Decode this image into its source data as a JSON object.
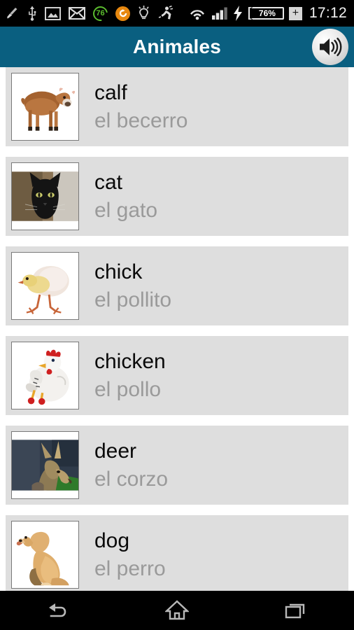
{
  "statusbar": {
    "clock": "17:12",
    "badge_count": "76",
    "battery_percent": "76%",
    "battery_plus": "+",
    "icons": [
      "broom-icon",
      "usb-icon",
      "screenshot-image-icon",
      "mail-icon",
      "cleaner-badge-icon",
      "orange-sync-icon",
      "lightbulb-icon",
      "runner-icon",
      "wifi-icon",
      "cell-signal-icon",
      "charging-bolt-icon",
      "battery-icon",
      "battery-plus-icon"
    ]
  },
  "titlebar": {
    "title": "Animales",
    "speaker_label": "speaker",
    "background_color": "#0a5f80"
  },
  "list": {
    "items": [
      {
        "english": "calf",
        "spanish": "el becerro",
        "image": "calf-photo"
      },
      {
        "english": "cat",
        "spanish": "el gato",
        "image": "cat-photo"
      },
      {
        "english": "chick",
        "spanish": "el pollito",
        "image": "chick-photo"
      },
      {
        "english": "chicken",
        "spanish": "el pollo",
        "image": "chicken-photo"
      },
      {
        "english": "deer",
        "spanish": "el corzo",
        "image": "deer-photo"
      },
      {
        "english": "dog",
        "spanish": "el perro",
        "image": "dog-photo"
      }
    ]
  },
  "navbar": {
    "back_label": "Back",
    "home_label": "Home",
    "recents_label": "Recents"
  },
  "colors": {
    "accent": "#0a5f80",
    "row_background": "#dedede",
    "english_text": "#0a0a0a",
    "spanish_text": "#9a9a9a",
    "page_background": "#ffffff",
    "system_bar": "#000000"
  }
}
